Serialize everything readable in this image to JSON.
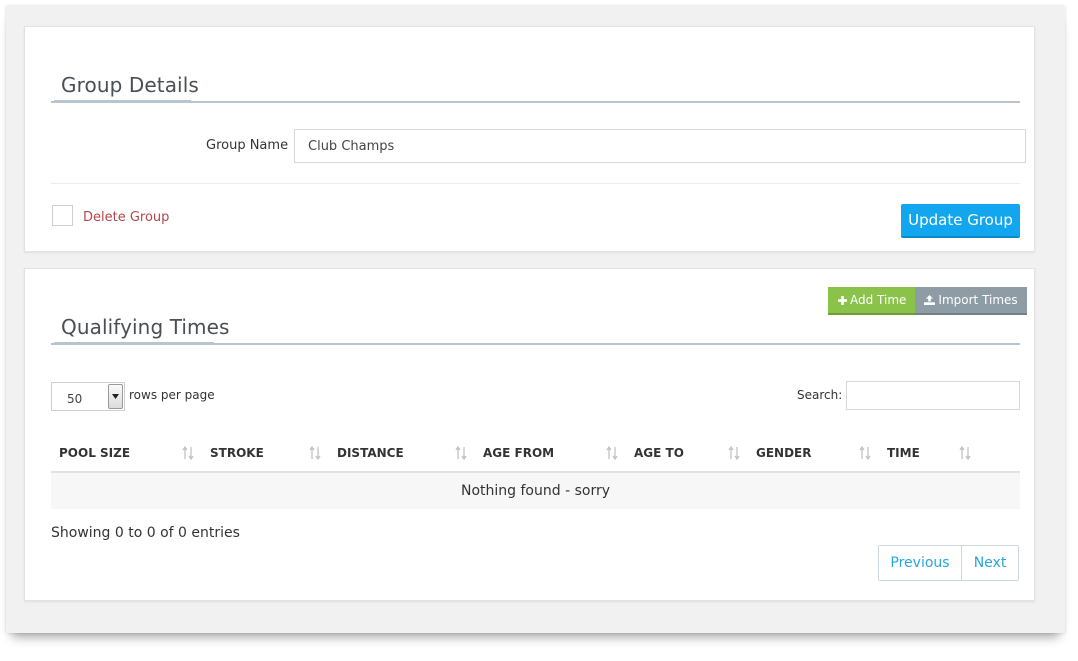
{
  "group_details": {
    "title": "Group Details",
    "group_name_label": "Group Name",
    "group_name_value": "Club Champs",
    "delete_label": "Delete Group",
    "update_button": "Update Group"
  },
  "qualifying_times": {
    "title": "Qualifying Times",
    "add_time_button": "Add Time",
    "import_times_button": "Import Times",
    "rows_per_page_value": "50",
    "rows_per_page_label": "rows per page",
    "search_label": "Search:",
    "columns": [
      "POOL SIZE",
      "STROKE",
      "DISTANCE",
      "AGE FROM",
      "AGE TO",
      "GENDER",
      "TIME"
    ],
    "empty_message": "Nothing found - sorry",
    "info": "Showing 0 to 0 of 0 entries",
    "previous": "Previous",
    "next": "Next"
  },
  "colors": {
    "primary": "#12a6ef",
    "green": "#8bc34a",
    "gray": "#8e9ca5",
    "delete_text": "#b3474a",
    "link": "#27a6d9"
  },
  "icons": [
    "plus-icon",
    "upload-icon",
    "dropdown-arrow-icon",
    "sort-icon"
  ]
}
